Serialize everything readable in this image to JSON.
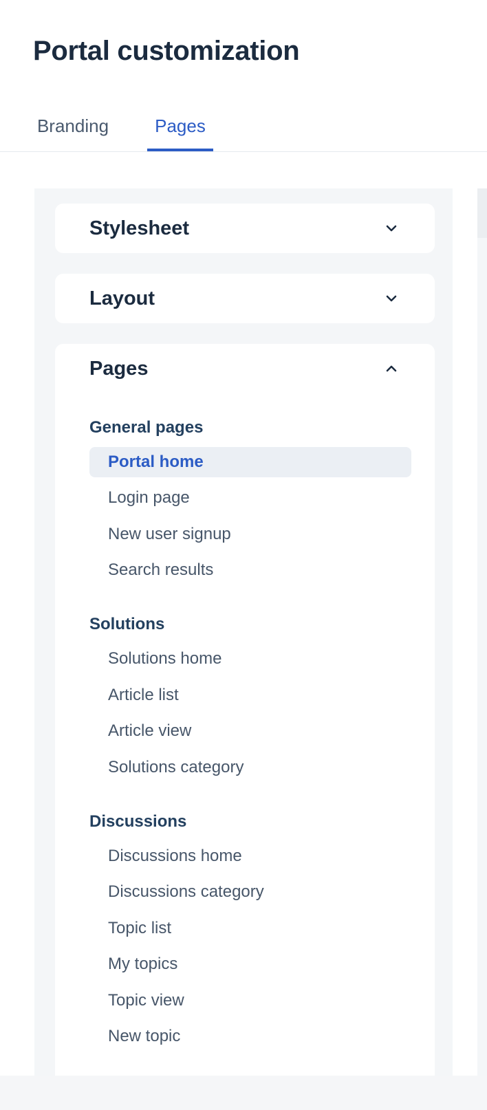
{
  "header": {
    "title": "Portal customization"
  },
  "tabs": [
    {
      "label": "Branding",
      "active": false
    },
    {
      "label": "Pages",
      "active": true
    }
  ],
  "accent_color": "#2c5cc5",
  "sidebar": {
    "sections": [
      {
        "title": "Stylesheet",
        "expanded": false,
        "icon": "chevron-down-icon"
      },
      {
        "title": "Layout",
        "expanded": false,
        "icon": "chevron-down-icon"
      },
      {
        "title": "Pages",
        "expanded": true,
        "icon": "chevron-up-icon"
      }
    ],
    "groups": [
      {
        "title": "General pages",
        "items": [
          {
            "label": "Portal home",
            "active": true
          },
          {
            "label": "Login page"
          },
          {
            "label": "New user signup"
          },
          {
            "label": "Search results"
          }
        ]
      },
      {
        "title": "Solutions",
        "items": [
          {
            "label": "Solutions home"
          },
          {
            "label": "Article list"
          },
          {
            "label": "Article view"
          },
          {
            "label": "Solutions category"
          }
        ]
      },
      {
        "title": "Discussions",
        "items": [
          {
            "label": "Discussions home"
          },
          {
            "label": "Discussions category"
          },
          {
            "label": "Topic list"
          },
          {
            "label": "My topics"
          },
          {
            "label": "Topic view"
          },
          {
            "label": "New topic"
          }
        ]
      }
    ]
  }
}
